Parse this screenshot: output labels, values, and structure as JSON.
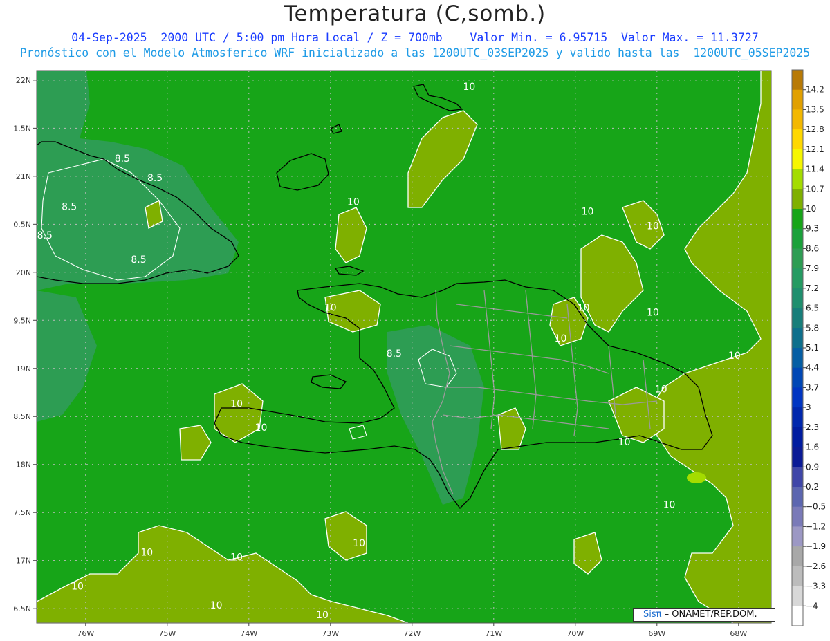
{
  "header": {
    "title": "Temperatura (C,somb.)",
    "subtitle": "04-Sep-2025  2000 UTC / 5:00 pm Hora Local / Z = 700mb    Valor Min. = 6.95715  Valor Max. = 11.3727",
    "forecast_note": "Pronóstico con el Modelo Atmosferico WRF inicializado a las 1200UTC_03SEP2025 y valido hasta las  1200UTC_05SEP2025"
  },
  "axes": {
    "x_ticks": [
      "76W",
      "75W",
      "74W",
      "73W",
      "72W",
      "71W",
      "70W",
      "69W",
      "68W"
    ],
    "y_ticks": [
      "22N",
      "1.5N",
      "21N",
      "0.5N",
      "20N",
      "9.5N",
      "19N",
      "8.5N",
      "18N",
      "7.5N",
      "17N",
      "6.5N"
    ]
  },
  "colorbar": {
    "labels": [
      "14.2",
      "13.5",
      "12.8",
      "12.1",
      "11.4",
      "10.7",
      "10",
      "9.3",
      "8.6",
      "7.9",
      "7.2",
      "6.5",
      "5.8",
      "5.1",
      "4.4",
      "3.7",
      "3",
      "2.3",
      "1.6",
      "0.9",
      "0.2",
      "−0.5",
      "−1.2",
      "−1.9",
      "−2.6",
      "−3.3",
      "−4"
    ],
    "colors": [
      "#b87a06",
      "#e1a000",
      "#f3b800",
      "#ffd800",
      "#f6f600",
      "#a4dc00",
      "#7fb000",
      "#17a518",
      "#1aa13a",
      "#2d9d53",
      "#259b62",
      "#1f8f6e",
      "#177e7a",
      "#0d6f8c",
      "#055ea4",
      "#0047b5",
      "#0035c2",
      "#0027ad",
      "#001ca0",
      "#0a1a96",
      "#3f46a8",
      "#5c66b0",
      "#7a7ab8",
      "#9c98c4",
      "#a8a8a8",
      "#bcbcbc",
      "#d8d8d8",
      "#ffffff"
    ]
  },
  "colors": {
    "background_field": "#17a518",
    "warm_field": "#7fb000",
    "cool_field": "#2d9d53",
    "hot_spot": "#a4dc00",
    "coastline": "#000000",
    "province_border": "#9a9a9a",
    "contour": "#ffffff",
    "grid": "#bdbdbd"
  },
  "contour_labels": [
    {
      "text": "10",
      "lon": -72.72,
      "lat": 20.7
    },
    {
      "text": "10",
      "lon": -71.3,
      "lat": 21.9
    },
    {
      "text": "10",
      "lon": -69.85,
      "lat": 20.6
    },
    {
      "text": "10",
      "lon": -69.05,
      "lat": 20.45
    },
    {
      "text": "10",
      "lon": -69.9,
      "lat": 19.6
    },
    {
      "text": "10",
      "lon": -70.18,
      "lat": 19.28
    },
    {
      "text": "10",
      "lon": -69.05,
      "lat": 19.55
    },
    {
      "text": "10",
      "lon": -68.05,
      "lat": 19.1
    },
    {
      "text": "10",
      "lon": -73.0,
      "lat": 19.6
    },
    {
      "text": "10",
      "lon": -74.15,
      "lat": 18.6
    },
    {
      "text": "10",
      "lon": -73.85,
      "lat": 18.35
    },
    {
      "text": "10",
      "lon": -68.95,
      "lat": 18.75
    },
    {
      "text": "10",
      "lon": -69.4,
      "lat": 18.2
    },
    {
      "text": "10",
      "lon": -68.85,
      "lat": 17.55
    },
    {
      "text": "10",
      "lon": -72.65,
      "lat": 17.15
    },
    {
      "text": "10",
      "lon": -75.25,
      "lat": 17.05
    },
    {
      "text": "10",
      "lon": -74.15,
      "lat": 17.0
    },
    {
      "text": "10",
      "lon": -76.1,
      "lat": 16.7
    },
    {
      "text": "10",
      "lon": -74.4,
      "lat": 16.5
    },
    {
      "text": "10",
      "lon": -73.1,
      "lat": 16.4
    },
    {
      "text": "8.5",
      "lon": -75.55,
      "lat": 21.15
    },
    {
      "text": "8.5",
      "lon": -75.15,
      "lat": 20.95
    },
    {
      "text": "8.5",
      "lon": -76.2,
      "lat": 20.65
    },
    {
      "text": "8.5",
      "lon": -76.5,
      "lat": 20.35
    },
    {
      "text": "8.5",
      "lon": -75.35,
      "lat": 20.1
    },
    {
      "text": "8.5",
      "lon": -72.22,
      "lat": 19.12
    }
  ],
  "credit": {
    "brand": "Sisπ",
    "text": "– ONAMET/REP.DOM."
  }
}
